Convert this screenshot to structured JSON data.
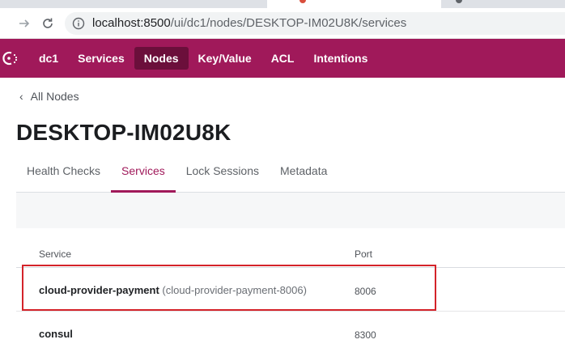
{
  "browser": {
    "address": {
      "host": "localhost:8500",
      "path": "/ui/dc1/nodes/DESKTOP-IM02U8K/services"
    }
  },
  "header": {
    "menu": [
      {
        "label": "dc1"
      },
      {
        "label": "Services"
      },
      {
        "label": "Nodes",
        "active": true
      },
      {
        "label": "Key/Value"
      },
      {
        "label": "ACL"
      },
      {
        "label": "Intentions"
      }
    ],
    "brand_color": "#a0195a"
  },
  "breadcrumb": {
    "back_label": "All Nodes"
  },
  "page": {
    "title": "DESKTOP-IM02U8K"
  },
  "tabs": [
    {
      "label": "Health Checks"
    },
    {
      "label": "Services",
      "active": true
    },
    {
      "label": "Lock Sessions"
    },
    {
      "label": "Metadata"
    }
  ],
  "services_table": {
    "headers": {
      "service": "Service",
      "port": "Port"
    },
    "rows": [
      {
        "name": "cloud-provider-payment",
        "id": "(cloud-provider-payment-8006)",
        "port": "8006"
      },
      {
        "name": "consul",
        "id": "",
        "port": "8300"
      }
    ]
  }
}
